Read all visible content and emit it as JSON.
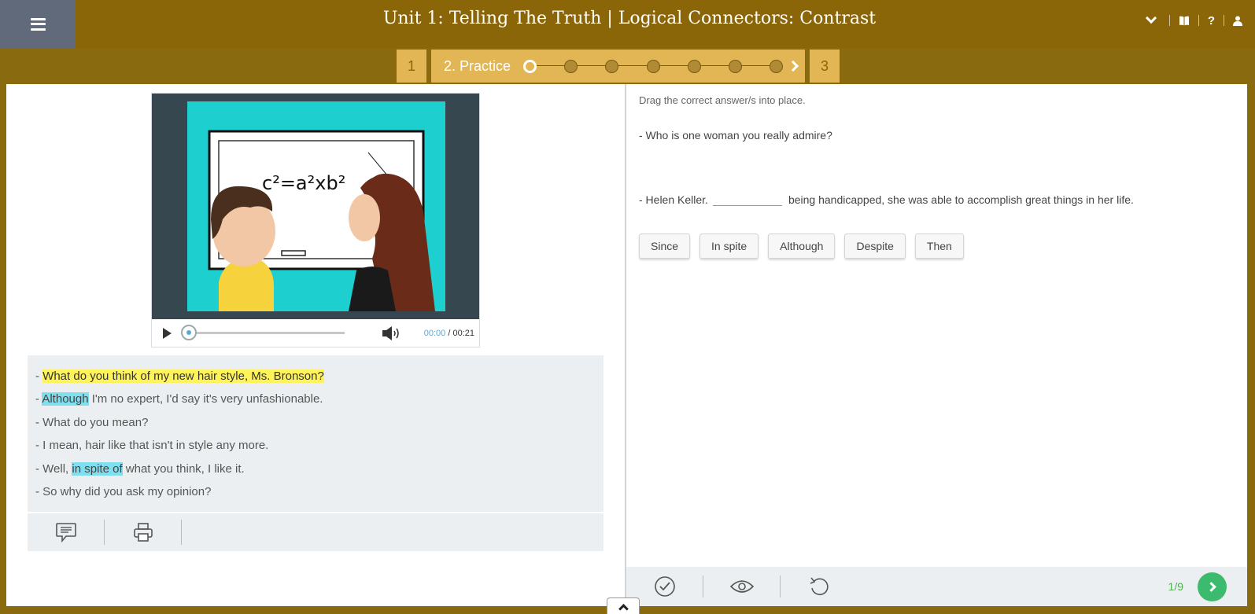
{
  "header": {
    "title": "Unit 1: Telling The Truth | Logical Connectors: Contrast",
    "help_label": "?"
  },
  "progress": {
    "step_prev": "1",
    "step_current": "2. Practice",
    "step_next": "3",
    "dots_total": 7,
    "dots_active": 1
  },
  "video": {
    "equation": "c²=a²xb²",
    "time_current": "00:00",
    "time_separator": " / ",
    "time_total": "00:21"
  },
  "transcript": {
    "lines": [
      {
        "prefix": "- ",
        "hl": "What do you think of my new hair style, Ms. Bronson?",
        "rest": ""
      },
      {
        "prefix": "- ",
        "hl": "Although",
        "rest": " I'm no expert, I'd say it's very unfashionable."
      },
      {
        "prefix": "- ",
        "text": "What do you mean?"
      },
      {
        "prefix": "- ",
        "text": "I mean, hair like that isn't in style any more."
      },
      {
        "prefix": "- Well, ",
        "hl": "in spite of",
        "rest": " what you think, I like it."
      },
      {
        "prefix": "- ",
        "text": "So why did you ask my opinion?"
      }
    ]
  },
  "exercise": {
    "instructions": "Drag the correct answer/s into place.",
    "question": "- Who is one woman you really admire?",
    "answer_before": "- Helen Keller.",
    "answer_after": "being handicapped, she was able to accomplish great things in her life.",
    "options": [
      "Since",
      "In spite",
      "Although",
      "Despite",
      "Then"
    ],
    "counter": "1/9"
  },
  "colors": {
    "header_bg": "#8a6608",
    "step_bg": "#e2b655",
    "menu_bg": "#606a7a",
    "highlight_yellow": "#fff35c",
    "highlight_cyan": "#7fdfee",
    "next_green": "#3cba6e"
  }
}
